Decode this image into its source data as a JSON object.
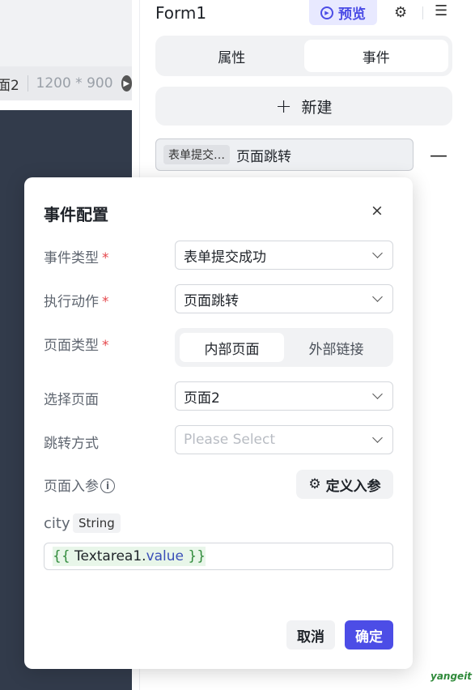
{
  "canvas": {
    "page_name": "面2",
    "dimensions": "1200 * 900",
    "play_icon": "play-icon"
  },
  "panel": {
    "form_title": "Form1",
    "preview_label": "预览",
    "tabs": [
      {
        "label": "属性",
        "active": false
      },
      {
        "label": "事件",
        "active": true
      }
    ],
    "new_label": "新建",
    "event": {
      "tag": "表单提交…",
      "name": "页面跳转",
      "remove": "—"
    }
  },
  "modal": {
    "title": "事件配置",
    "close": "×",
    "event_type": {
      "label": "事件类型",
      "value": "表单提交成功"
    },
    "action": {
      "label": "执行动作",
      "value": "页面跳转"
    },
    "page_type": {
      "label": "页面类型",
      "options": [
        "内部页面",
        "外部链接"
      ],
      "selected": "内部页面"
    },
    "select_page": {
      "label": "选择页面",
      "value": "页面2"
    },
    "jump_mode": {
      "label": "跳转方式",
      "placeholder": "Please Select"
    },
    "params": {
      "label": "页面入参",
      "define_label": "定义入参"
    },
    "param": {
      "name": "city",
      "type": "String",
      "expr_open": "{{",
      "expr_obj": "Textarea1.",
      "expr_prop": "value",
      "expr_close": "}}"
    },
    "cancel_label": "取消",
    "confirm_label": "确定"
  },
  "watermark": "yangeit",
  "colors": {
    "accent": "#4c4de6",
    "accent_light": "#e8e9ff",
    "required": "#e5484d",
    "canvas_dark": "#323b4b"
  }
}
